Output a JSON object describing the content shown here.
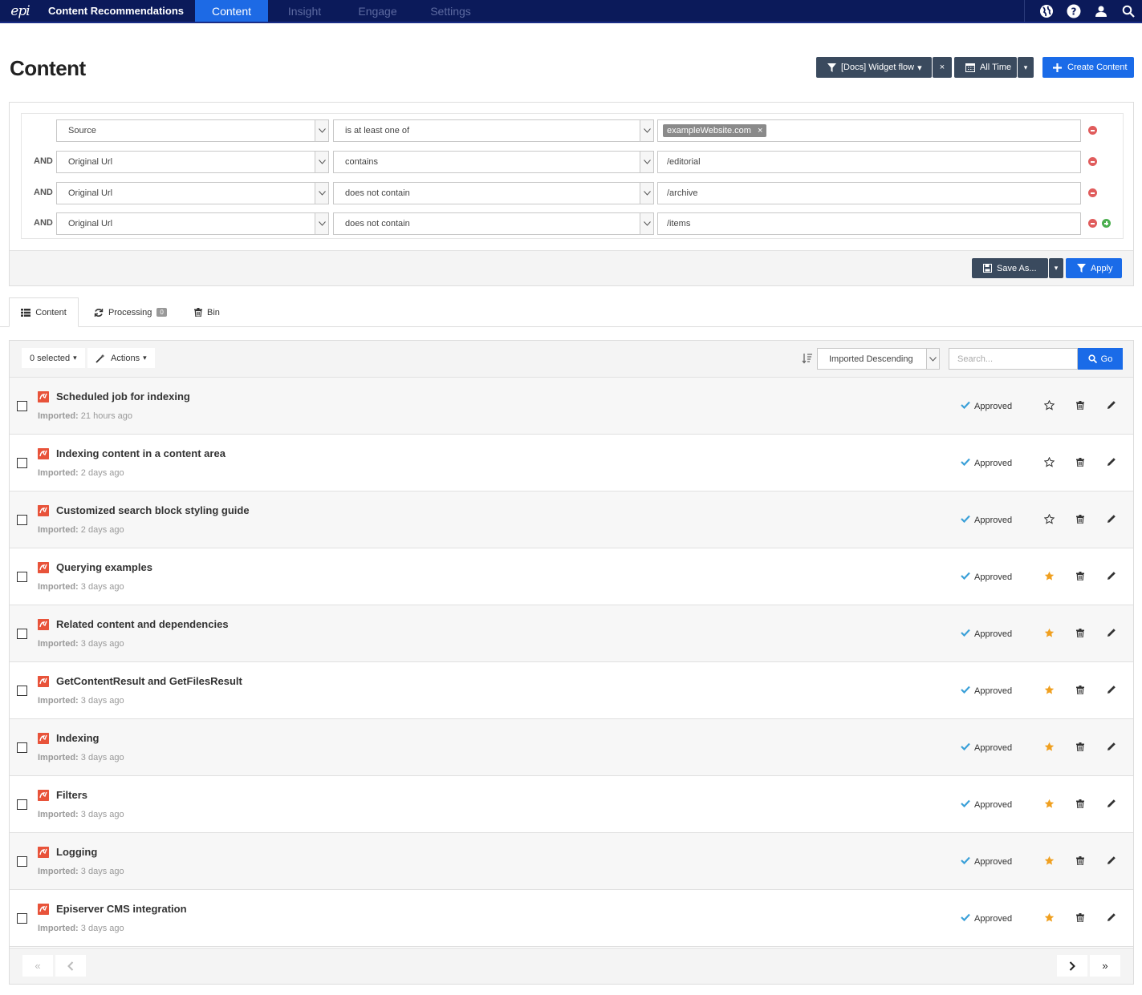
{
  "nav": {
    "logo": "epi",
    "brand": "Content Recommendations",
    "tabs": [
      "Content",
      "Insight",
      "Engage",
      "Settings"
    ],
    "active_tab": "Content"
  },
  "page_title": "Content",
  "header_buttons": {
    "filter_label": "[Docs] Widget flow",
    "filter_clear": "×",
    "time_label": "All Time",
    "create_label": "Create Content"
  },
  "filters": [
    {
      "conj": "",
      "field": "Source",
      "operator": "is at least one of",
      "value": "",
      "chip": "exampleWebsite.com",
      "chip_remove": "×"
    },
    {
      "conj": "AND",
      "field": "Original Url",
      "operator": "contains",
      "value": "/editorial"
    },
    {
      "conj": "AND",
      "field": "Original Url",
      "operator": "does not contain",
      "value": "/archive"
    },
    {
      "conj": "AND",
      "field": "Original Url",
      "operator": "does not contain",
      "value": "/items"
    }
  ],
  "filter_actions": {
    "save_as": "Save As...",
    "apply": "Apply"
  },
  "tabs": {
    "content": "Content",
    "processing": "Processing",
    "processing_count": "0",
    "bin": "Bin"
  },
  "toolbar": {
    "selected": "0 selected",
    "actions": "Actions",
    "sort": "Imported Descending",
    "search_placeholder": "Search...",
    "go": "Go"
  },
  "meta_label": "Imported:",
  "items": [
    {
      "title": "Scheduled job for indexing",
      "imported": "21 hours ago",
      "status": "Approved",
      "starred": false
    },
    {
      "title": "Indexing content in a content area",
      "imported": "2 days ago",
      "status": "Approved",
      "starred": false
    },
    {
      "title": "Customized search block styling guide",
      "imported": "2 days ago",
      "status": "Approved",
      "starred": false
    },
    {
      "title": "Querying examples",
      "imported": "3 days ago",
      "status": "Approved",
      "starred": true
    },
    {
      "title": "Related content and dependencies",
      "imported": "3 days ago",
      "status": "Approved",
      "starred": true
    },
    {
      "title": "GetContentResult and GetFilesResult",
      "imported": "3 days ago",
      "status": "Approved",
      "starred": true
    },
    {
      "title": "Indexing",
      "imported": "3 days ago",
      "status": "Approved",
      "starred": true
    },
    {
      "title": "Filters",
      "imported": "3 days ago",
      "status": "Approved",
      "starred": true
    },
    {
      "title": "Logging",
      "imported": "3 days ago",
      "status": "Approved",
      "starred": true
    },
    {
      "title": "Episerver CMS integration",
      "imported": "3 days ago",
      "status": "Approved",
      "starred": true
    }
  ],
  "pager": {
    "first": "«",
    "last": "»"
  },
  "colors": {
    "nav": "#0b1a5a",
    "accent": "#1a6be8",
    "star": "#f0a020",
    "approved": "#3aa0d8",
    "item_icon": "#e8533a"
  }
}
